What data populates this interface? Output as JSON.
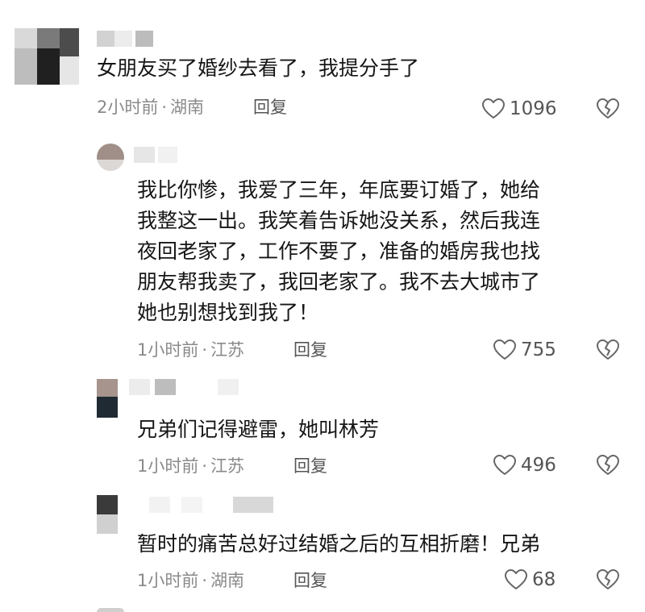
{
  "comments": [
    {
      "text": "女朋友买了婚纱去看了，我提分手了",
      "time": "2小时前",
      "location": "湖南",
      "reply_label": "回复",
      "likes": "1096"
    },
    {
      "text": "我比你惨，我爱了三年，年底要订婚了，她给\n我整这一出。我笑着告诉她没关系，然后我连\n夜回老家了，工作不要了，准备的婚房我也找\n朋友帮我卖了，我回老家了。我不去大城市了\n她也别想找到我了！",
      "time": "1小时前",
      "location": "江苏",
      "reply_label": "回复",
      "likes": "755"
    },
    {
      "text": "兄弟们记得避雷，她叫林芳",
      "time": "1小时前",
      "location": "江苏",
      "reply_label": "回复",
      "likes": "496"
    },
    {
      "text": "暂时的痛苦总好过结婚之后的互相折磨！兄弟",
      "time": "1小时前",
      "location": "湖南",
      "reply_label": "回复",
      "likes": "68"
    }
  ],
  "separator": "·",
  "icons": {
    "like": "heart-outline-icon",
    "dislike": "broken-heart-icon"
  },
  "colors": {
    "text": "#161616",
    "meta": "#8a8a8a",
    "icon": "#666666"
  }
}
